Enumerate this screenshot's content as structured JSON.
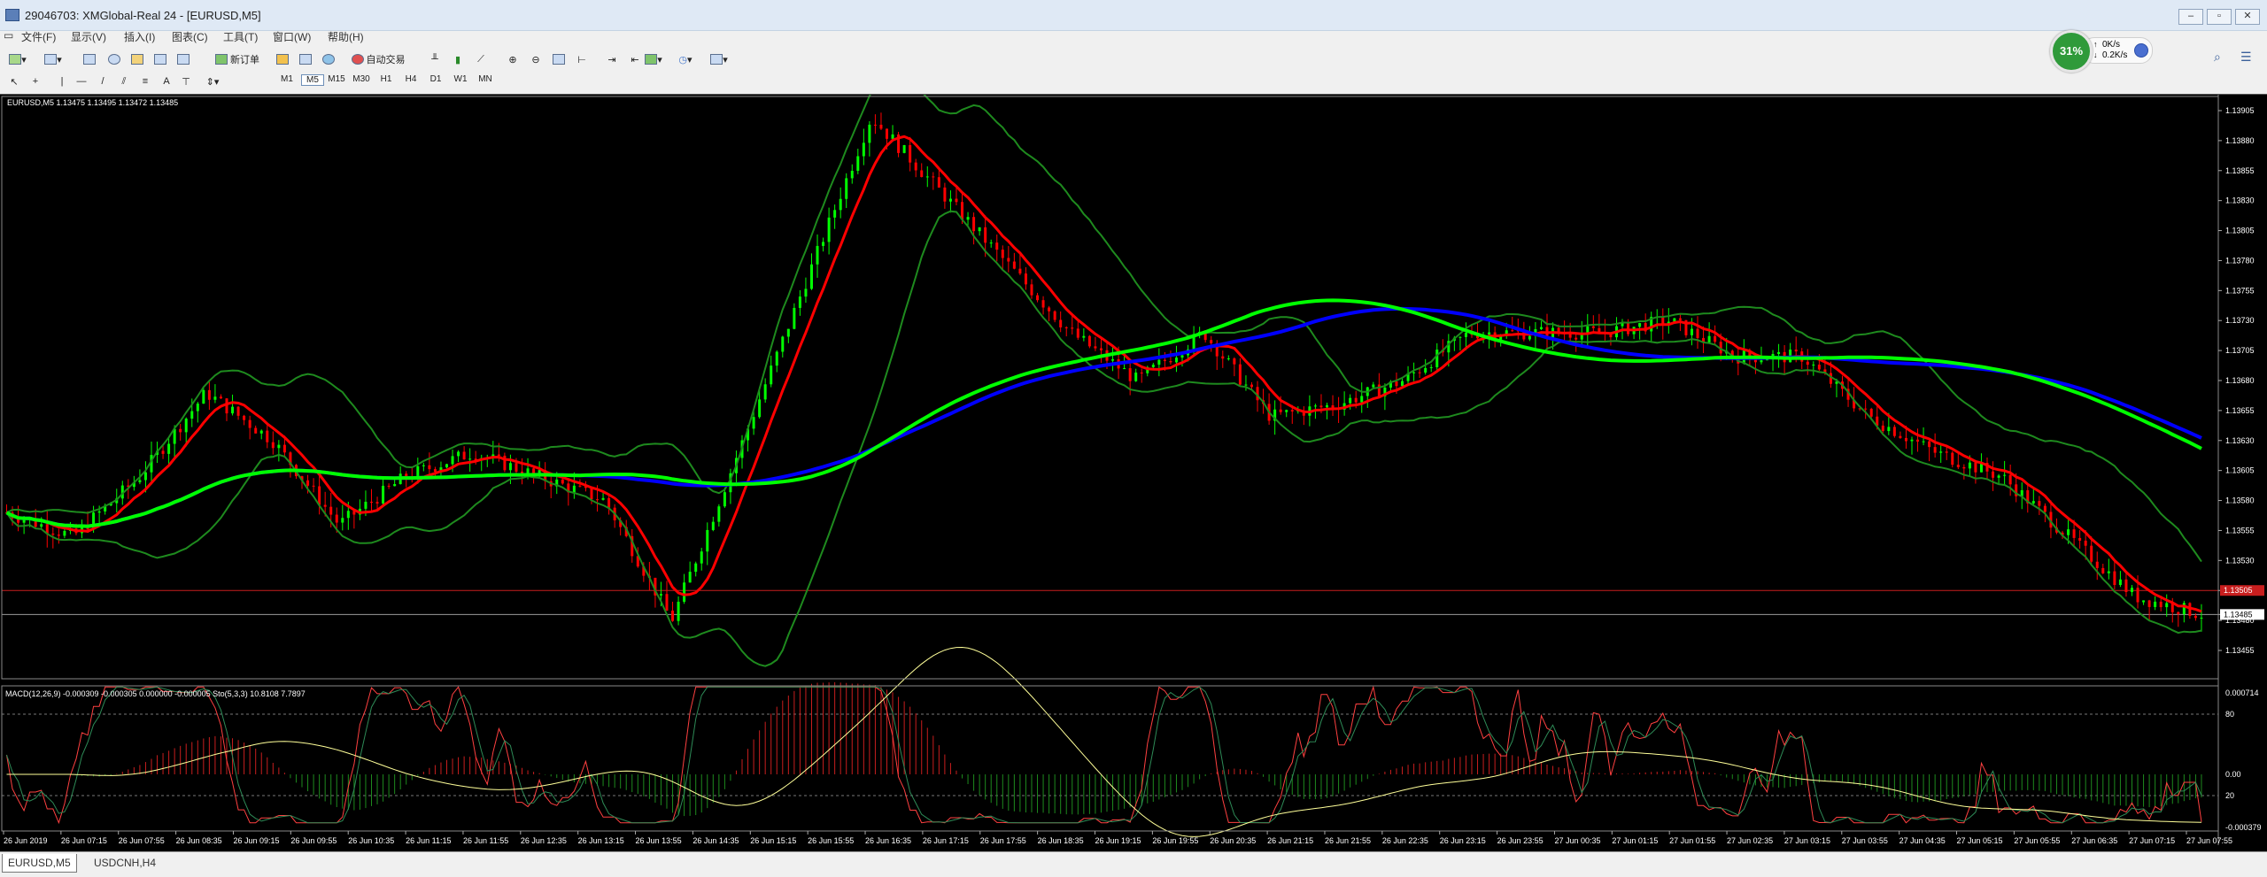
{
  "window": {
    "title": "29046703: XMGlobal-Real 24 - [EURUSD,M5]"
  },
  "netspeed": {
    "percent": "31%",
    "up": "0K/s",
    "down": "0.2K/s"
  },
  "menu": [
    "文件(F)",
    "显示(V)",
    "插入(I)",
    "图表(C)",
    "工具(T)",
    "窗口(W)",
    "帮助(H)"
  ],
  "toolbar": {
    "new_order": "新订单",
    "autotrade": "自动交易"
  },
  "timeframes": [
    "M1",
    "M5",
    "M15",
    "M30",
    "H1",
    "H4",
    "D1",
    "W1",
    "MN"
  ],
  "active_timeframe": "M5",
  "chart": {
    "header": "EURUSD,M5  1.13475 1.13495 1.13472 1.13485",
    "price_labels": [
      "1.13905",
      "1.13880",
      "1.13855",
      "1.13830",
      "1.13805",
      "1.13780",
      "1.13755",
      "1.13730",
      "1.13705",
      "1.13680",
      "1.13655",
      "1.13630",
      "1.13605",
      "1.13580",
      "1.13555",
      "1.13530",
      "1.13505",
      "1.13485",
      "1.13480",
      "1.13455"
    ],
    "current_price": "1.13485",
    "red_line_label": "1.13505",
    "time_labels": [
      "26 Jun 2019",
      "26 Jun 07:15",
      "26 Jun 07:55",
      "26 Jun 08:35",
      "26 Jun 09:15",
      "26 Jun 09:55",
      "26 Jun 10:35",
      "26 Jun 11:15",
      "26 Jun 11:55",
      "26 Jun 12:35",
      "26 Jun 13:15",
      "26 Jun 13:55",
      "26 Jun 14:35",
      "26 Jun 15:15",
      "26 Jun 15:55",
      "26 Jun 16:35",
      "26 Jun 17:15",
      "26 Jun 17:55",
      "26 Jun 18:35",
      "26 Jun 19:15",
      "26 Jun 19:55",
      "26 Jun 20:35",
      "26 Jun 21:15",
      "26 Jun 21:55",
      "26 Jun 22:35",
      "26 Jun 23:15",
      "26 Jun 23:55",
      "27 Jun 00:35",
      "27 Jun 01:15",
      "27 Jun 01:55",
      "27 Jun 02:35",
      "27 Jun 03:15",
      "27 Jun 03:55",
      "27 Jun 04:35",
      "27 Jun 05:15",
      "27 Jun 05:55",
      "27 Jun 06:35",
      "27 Jun 07:15",
      "27 Jun 07:55"
    ],
    "colors": {
      "background": "#000000",
      "bull": "#00ff00",
      "bear": "#ff0000",
      "ma_fast": "#ff0000",
      "ma_slow_blue": "#0000ff",
      "ma_slow_green": "#00ff00",
      "bollinger": "#1e8a1e",
      "stoch_main": "#ff4040",
      "stoch_signal": "#2e8b57",
      "macd_signal": "#ffff99"
    }
  },
  "subwindow": {
    "header": "MACD(12,26,9) -0.000309 -0.000305 0.000000 -0.000005  Sto(5,3,3) 10.8108 7.7897",
    "levels": [
      "0.000714",
      "80",
      "0.00",
      "20",
      "-0.000379"
    ]
  },
  "tabs": [
    "EURUSD,M5",
    "USDCNH,H4"
  ],
  "chart_data": {
    "type": "line",
    "title": "EURUSD,M5",
    "series": [
      {
        "name": "EURUSD",
        "x": [
          "26 Jun 06:35",
          "26 Jun 07:55",
          "26 Jun 09:15",
          "26 Jun 09:55",
          "26 Jun 10:35",
          "26 Jun 11:55",
          "26 Jun 12:35",
          "26 Jun 13:55",
          "26 Jun 15:15",
          "26 Jun 15:55",
          "26 Jun 16:35",
          "26 Jun 17:15",
          "26 Jun 17:55",
          "26 Jun 18:35",
          "26 Jun 19:15",
          "26 Jun 19:55",
          "26 Jun 20:35",
          "26 Jun 21:15",
          "26 Jun 21:55",
          "26 Jun 22:35",
          "26 Jun 23:15",
          "26 Jun 23:55",
          "27 Jun 00:35",
          "27 Jun 01:15",
          "27 Jun 01:55",
          "27 Jun 02:35",
          "27 Jun 03:15",
          "27 Jun 03:55",
          "27 Jun 04:35",
          "27 Jun 05:15",
          "27 Jun 05:55",
          "27 Jun 06:35",
          "27 Jun 07:15",
          "27 Jun 07:55"
        ],
        "y": [
          1.1357,
          1.1355,
          1.136,
          1.1367,
          1.1363,
          1.1356,
          1.136,
          1.1362,
          1.136,
          1.1358,
          1.1348,
          1.1362,
          1.1376,
          1.139,
          1.1384,
          1.1378,
          1.1372,
          1.1368,
          1.1372,
          1.1365,
          1.1366,
          1.1368,
          1.1372,
          1.1372,
          1.1372,
          1.1373,
          1.137,
          1.137,
          1.1365,
          1.1362,
          1.136,
          1.1355,
          1.135,
          1.13485
        ]
      }
    ],
    "ylim": [
      1.13455,
      1.13905
    ]
  }
}
